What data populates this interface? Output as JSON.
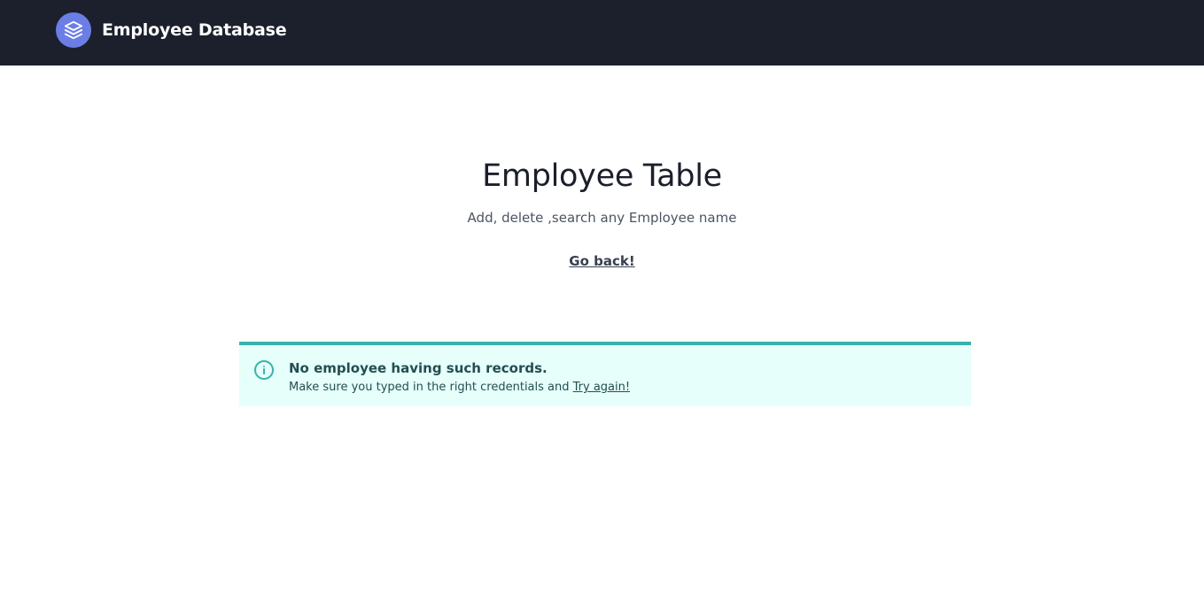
{
  "navbar": {
    "brand_title": "Employee Database",
    "logo_icon": "layers-icon",
    "logo_color": "#6b7ee6",
    "background": "#1b202c"
  },
  "hero": {
    "title": "Employee Table",
    "subtitle": "Add, delete ,search any Employee name",
    "back_link": "Go back!"
  },
  "alert": {
    "icon": "info-icon",
    "accent_color": "#38b2ac",
    "title": "No employee having such records.",
    "message": "Make sure you typed in the right credentials and ",
    "retry_link": "Try again!"
  }
}
